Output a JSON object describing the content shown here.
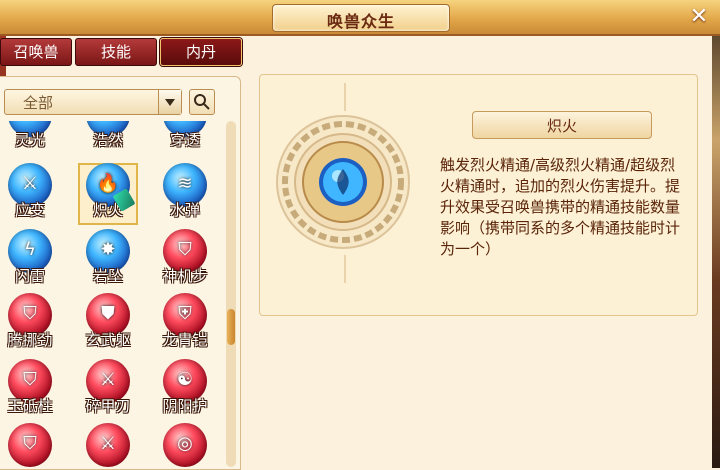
{
  "window": {
    "title": "唤兽众生"
  },
  "tabs": [
    {
      "label": "召唤兽",
      "active": false
    },
    {
      "label": "技能",
      "active": false
    },
    {
      "label": "内丹",
      "active": true
    }
  ],
  "filter": {
    "selected": "全部"
  },
  "skills": [
    {
      "label": "灵光",
      "color": "blue",
      "glyph": "✦"
    },
    {
      "label": "浩然",
      "color": "blue",
      "glyph": "✦"
    },
    {
      "label": "穿透",
      "color": "blue",
      "glyph": "✦"
    },
    {
      "label": "应变",
      "color": "blue",
      "glyph": "⚔"
    },
    {
      "label": "炽火",
      "color": "blue",
      "glyph": "🔥",
      "selected": true
    },
    {
      "label": "水弹",
      "color": "blue",
      "glyph": "≋"
    },
    {
      "label": "闪雷",
      "color": "blue",
      "glyph": "ϟ"
    },
    {
      "label": "岩坠",
      "color": "blue",
      "glyph": "✸"
    },
    {
      "label": "神机步",
      "color": "red",
      "glyph": "⛉"
    },
    {
      "label": "腾挪劲",
      "color": "red",
      "glyph": "⛉"
    },
    {
      "label": "玄武躯",
      "color": "red",
      "glyph": "⛊"
    },
    {
      "label": "龙胄铠",
      "color": "red",
      "glyph": "⛨"
    },
    {
      "label": "玉砥柱",
      "color": "red",
      "glyph": "⛉"
    },
    {
      "label": "碎甲刃",
      "color": "red",
      "glyph": "⚔"
    },
    {
      "label": "阴阳护",
      "color": "red",
      "glyph": "☯"
    },
    {
      "label": "",
      "color": "red",
      "glyph": "⛉"
    },
    {
      "label": "",
      "color": "red",
      "glyph": "⚔"
    },
    {
      "label": "",
      "color": "red",
      "glyph": "◎"
    }
  ],
  "detail": {
    "name": "炽火",
    "description": "触发烈火精通/高级烈火精通/超级烈火精通时，追加的烈火伤害提升。提升效果受召唤兽携带的精通技能数量影响（携带同系的多个精通技能时计为一个）"
  },
  "colors": {
    "accent": "#e3a84a",
    "text": "#5a2408"
  }
}
